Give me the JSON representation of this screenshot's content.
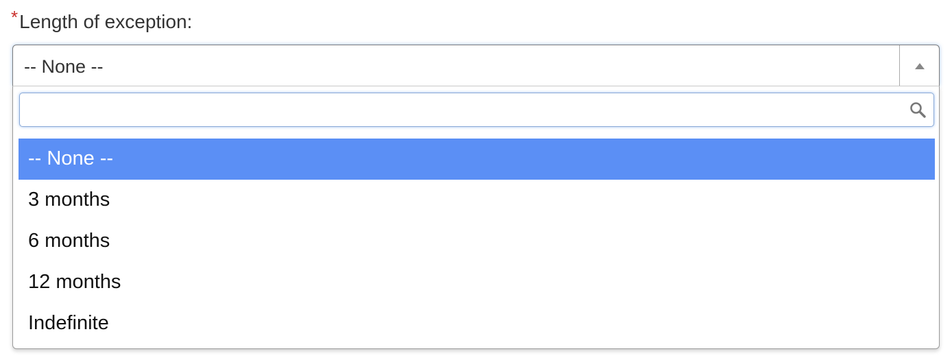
{
  "field": {
    "required_marker": "*",
    "label": "Length of exception:"
  },
  "select": {
    "selected_value": "-- None --",
    "arrow_icon": "triangle-up-icon",
    "open": true
  },
  "dropdown": {
    "search": {
      "value": "",
      "placeholder": "",
      "icon": "search-icon"
    },
    "options": [
      {
        "label": "-- None --",
        "highlighted": true
      },
      {
        "label": "3 months",
        "highlighted": false
      },
      {
        "label": "6 months",
        "highlighted": false
      },
      {
        "label": "12 months",
        "highlighted": false
      },
      {
        "label": "Indefinite",
        "highlighted": false
      }
    ]
  },
  "colors": {
    "required": "#c9302c",
    "highlight": "#5b8ff5",
    "focus_glow": "#669be6"
  }
}
